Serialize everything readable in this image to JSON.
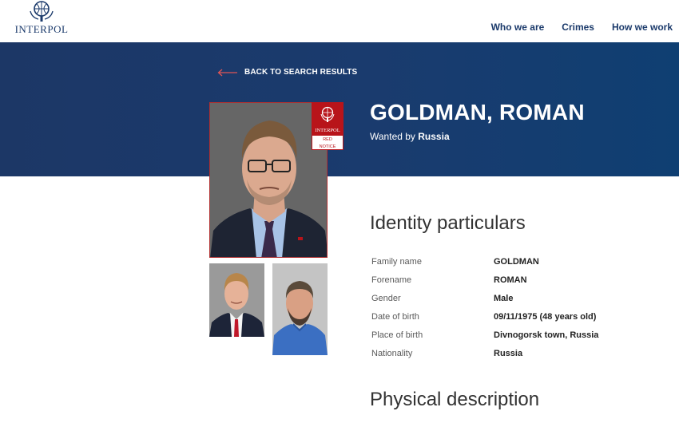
{
  "brand": {
    "logo_text": "INTERPOL"
  },
  "nav": {
    "items": [
      "Who we are",
      "Crimes",
      "How we work"
    ]
  },
  "back_link": {
    "label": "BACK TO SEARCH RESULTS"
  },
  "person": {
    "name": "GOLDMAN, ROMAN",
    "wanted_prefix": "Wanted by",
    "wanted_by": "Russia"
  },
  "badge": {
    "org": "INTERPOL",
    "line1": "RED",
    "line2": "NOTICE"
  },
  "identity": {
    "title": "Identity particulars",
    "rows": [
      {
        "label": "Family name",
        "value": "GOLDMAN"
      },
      {
        "label": "Forename",
        "value": "ROMAN"
      },
      {
        "label": "Gender",
        "value": "Male"
      },
      {
        "label": "Date of birth",
        "value": "09/11/1975 (48 years old)"
      },
      {
        "label": "Place of birth",
        "value": "Divnogorsk town, Russia"
      },
      {
        "label": "Nationality",
        "value": "Russia"
      }
    ]
  },
  "physical": {
    "title": "Physical description"
  },
  "colors": {
    "navy": "#1b3a6b",
    "red": "#b8141a"
  }
}
